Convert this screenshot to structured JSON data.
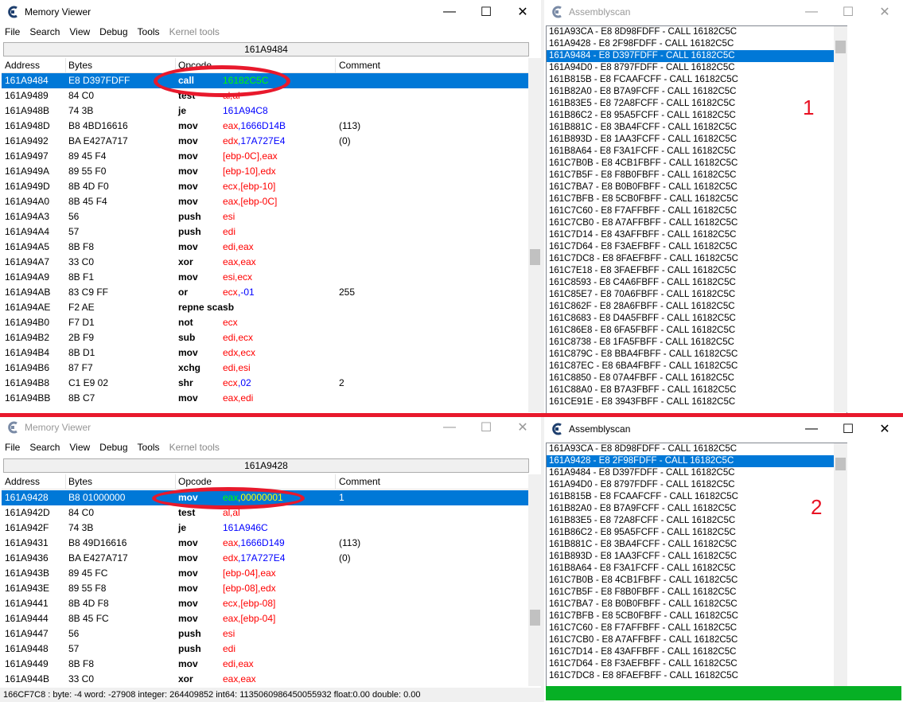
{
  "top_memory_viewer": {
    "title": "Memory Viewer",
    "menu": [
      "File",
      "Search",
      "View",
      "Debug",
      "Tools",
      "Kernel tools"
    ],
    "address_bar": "161A9484",
    "columns": {
      "address": "Address",
      "bytes": "Bytes",
      "opcode": "Opcode",
      "comment": "Comment"
    },
    "rows": [
      {
        "addr": "161A9484",
        "bytes": "E8 D397FDFF",
        "op": "call",
        "a1": "16182C5C",
        "a2": "",
        "comment": "",
        "selected": true
      },
      {
        "addr": "161A9489",
        "bytes": "84 C0",
        "op": "test",
        "a1": "al",
        "a2": ",al",
        "comment": ""
      },
      {
        "addr": "161A948B",
        "bytes": "74 3B",
        "op": "je",
        "a1": "161A94C8",
        "a2": "",
        "comment": ""
      },
      {
        "addr": "161A948D",
        "bytes": "B8 4BD16616",
        "op": "mov",
        "a1": "eax",
        "a2": ",1666D14B",
        "comment": "(113)"
      },
      {
        "addr": "161A9492",
        "bytes": "BA E427A717",
        "op": "mov",
        "a1": "edx",
        "a2": ",17A727E4",
        "comment": "(0)"
      },
      {
        "addr": "161A9497",
        "bytes": "89 45 F4",
        "op": "mov",
        "a1": "[ebp-0C]",
        "a2": ",eax",
        "comment": ""
      },
      {
        "addr": "161A949A",
        "bytes": "89 55 F0",
        "op": "mov",
        "a1": "[ebp-10]",
        "a2": ",edx",
        "comment": ""
      },
      {
        "addr": "161A949D",
        "bytes": "8B 4D F0",
        "op": "mov",
        "a1": "ecx",
        "a2": ",[ebp-10]",
        "comment": ""
      },
      {
        "addr": "161A94A0",
        "bytes": "8B 45 F4",
        "op": "mov",
        "a1": "eax",
        "a2": ",[ebp-0C]",
        "comment": ""
      },
      {
        "addr": "161A94A3",
        "bytes": "56",
        "op": "push",
        "a1": "esi",
        "a2": "",
        "comment": ""
      },
      {
        "addr": "161A94A4",
        "bytes": "57",
        "op": "push",
        "a1": "edi",
        "a2": "",
        "comment": ""
      },
      {
        "addr": "161A94A5",
        "bytes": "8B F8",
        "op": "mov",
        "a1": "edi",
        "a2": ",eax",
        "comment": ""
      },
      {
        "addr": "161A94A7",
        "bytes": "33 C0",
        "op": "xor",
        "a1": "eax",
        "a2": ",eax",
        "comment": ""
      },
      {
        "addr": "161A94A9",
        "bytes": "8B F1",
        "op": "mov",
        "a1": "esi",
        "a2": ",ecx",
        "comment": ""
      },
      {
        "addr": "161A94AB",
        "bytes": "83 C9 FF",
        "op": "or",
        "a1": "ecx",
        "a2": ",-01",
        "comment": "255"
      },
      {
        "addr": "161A94AE",
        "bytes": "F2 AE",
        "op": "repne scasb",
        "a1": "",
        "a2": "",
        "comment": ""
      },
      {
        "addr": "161A94B0",
        "bytes": "F7 D1",
        "op": "not",
        "a1": "ecx",
        "a2": "",
        "comment": ""
      },
      {
        "addr": "161A94B2",
        "bytes": "2B F9",
        "op": "sub",
        "a1": "edi",
        "a2": ",ecx",
        "comment": ""
      },
      {
        "addr": "161A94B4",
        "bytes": "8B D1",
        "op": "mov",
        "a1": "edx",
        "a2": ",ecx",
        "comment": ""
      },
      {
        "addr": "161A94B6",
        "bytes": "87 F7",
        "op": "xchg",
        "a1": "edi",
        "a2": ",esi",
        "comment": ""
      },
      {
        "addr": "161A94B8",
        "bytes": "C1 E9 02",
        "op": "shr",
        "a1": "ecx",
        "a2": ",02",
        "comment": "2"
      },
      {
        "addr": "161A94BB",
        "bytes": "8B C7",
        "op": "mov",
        "a1": "eax",
        "a2": ",edi",
        "comment": ""
      }
    ]
  },
  "bottom_memory_viewer": {
    "title": "Memory Viewer",
    "menu": [
      "File",
      "Search",
      "View",
      "Debug",
      "Tools",
      "Kernel tools"
    ],
    "address_bar": "161A9428",
    "columns": {
      "address": "Address",
      "bytes": "Bytes",
      "opcode": "Opcode",
      "comment": "Comment"
    },
    "rows": [
      {
        "addr": "161A9428",
        "bytes": "B8 01000000",
        "op": "mov",
        "a1": "eax",
        "a2": ",00000001",
        "comment": "1",
        "selected": true
      },
      {
        "addr": "161A942D",
        "bytes": "84 C0",
        "op": "test",
        "a1": "al",
        "a2": ",al",
        "comment": ""
      },
      {
        "addr": "161A942F",
        "bytes": "74 3B",
        "op": "je",
        "a1": "161A946C",
        "a2": "",
        "comment": ""
      },
      {
        "addr": "161A9431",
        "bytes": "B8 49D16616",
        "op": "mov",
        "a1": "eax",
        "a2": ",1666D149",
        "comment": "(113)"
      },
      {
        "addr": "161A9436",
        "bytes": "BA E427A717",
        "op": "mov",
        "a1": "edx",
        "a2": ",17A727E4",
        "comment": "(0)"
      },
      {
        "addr": "161A943B",
        "bytes": "89 45 FC",
        "op": "mov",
        "a1": "[ebp-04]",
        "a2": ",eax",
        "comment": ""
      },
      {
        "addr": "161A943E",
        "bytes": "89 55 F8",
        "op": "mov",
        "a1": "[ebp-08]",
        "a2": ",edx",
        "comment": ""
      },
      {
        "addr": "161A9441",
        "bytes": "8B 4D F8",
        "op": "mov",
        "a1": "ecx",
        "a2": ",[ebp-08]",
        "comment": ""
      },
      {
        "addr": "161A9444",
        "bytes": "8B 45 FC",
        "op": "mov",
        "a1": "eax",
        "a2": ",[ebp-04]",
        "comment": ""
      },
      {
        "addr": "161A9447",
        "bytes": "56",
        "op": "push",
        "a1": "esi",
        "a2": "",
        "comment": ""
      },
      {
        "addr": "161A9448",
        "bytes": "57",
        "op": "push",
        "a1": "edi",
        "a2": "",
        "comment": ""
      },
      {
        "addr": "161A9449",
        "bytes": "8B F8",
        "op": "mov",
        "a1": "edi",
        "a2": ",eax",
        "comment": ""
      },
      {
        "addr": "161A944B",
        "bytes": "33 C0",
        "op": "xor",
        "a1": "eax",
        "a2": ",eax",
        "comment": ""
      }
    ],
    "status": "166CF7C8 : byte: -4 word: -27908 integer: 264409852 int64: 1135060986450055932 float:0.00 double: 0.00"
  },
  "top_assemblyscan": {
    "title": "Assemblyscan",
    "annotation": "1",
    "items": [
      "161A93CA - E8 8D98FDFF - CALL 16182C5C",
      "161A9428 - E8 2F98FDFF - CALL 16182C5C",
      "161A9484 - E8 D397FDFF - CALL 16182C5C",
      "161A94D0 - E8 8797FDFF - CALL 16182C5C",
      "161B815B - E8 FCAAFCFF - CALL 16182C5C",
      "161B82A0 - E8 B7A9FCFF - CALL 16182C5C",
      "161B83E5 - E8 72A8FCFF - CALL 16182C5C",
      "161B86C2 - E8 95A5FCFF - CALL 16182C5C",
      "161B881C - E8 3BA4FCFF - CALL 16182C5C",
      "161B893D - E8 1AA3FCFF - CALL 16182C5C",
      "161B8A64 - E8 F3A1FCFF - CALL 16182C5C",
      "161C7B0B - E8 4CB1FBFF - CALL 16182C5C",
      "161C7B5F - E8 F8B0FBFF - CALL 16182C5C",
      "161C7BA7 - E8 B0B0FBFF - CALL 16182C5C",
      "161C7BFB - E8 5CB0FBFF - CALL 16182C5C",
      "161C7C60 - E8 F7AFFBFF - CALL 16182C5C",
      "161C7CB0 - E8 A7AFFBFF - CALL 16182C5C",
      "161C7D14 - E8 43AFFBFF - CALL 16182C5C",
      "161C7D64 - E8 F3AEFBFF - CALL 16182C5C",
      "161C7DC8 - E8 8FAEFBFF - CALL 16182C5C",
      "161C7E18 - E8 3FAEFBFF - CALL 16182C5C",
      "161C8593 - E8 C4A6FBFF - CALL 16182C5C",
      "161C85E7 - E8 70A6FBFF - CALL 16182C5C",
      "161C862F - E8 28A6FBFF - CALL 16182C5C",
      "161C8683 - E8 D4A5FBFF - CALL 16182C5C",
      "161C86E8 - E8 6FA5FBFF - CALL 16182C5C",
      "161C8738 - E8 1FA5FBFF - CALL 16182C5C",
      "161C879C - E8 BBA4FBFF - CALL 16182C5C",
      "161C87EC - E8 6BA4FBFF - CALL 16182C5C",
      "161C8850 - E8 07A4FBFF - CALL 16182C5C",
      "161C88A0 - E8 B7A3FBFF - CALL 16182C5C",
      "161CE91E - E8 3943FBFF - CALL 16182C5C"
    ],
    "selected_index": 2
  },
  "bottom_assemblyscan": {
    "title": "Assemblyscan",
    "annotation": "2",
    "items": [
      "161A93CA - E8 8D98FDFF - CALL 16182C5C",
      "161A9428 - E8 2F98FDFF - CALL 16182C5C",
      "161A9484 - E8 D397FDFF - CALL 16182C5C",
      "161A94D0 - E8 8797FDFF - CALL 16182C5C",
      "161B815B - E8 FCAAFCFF - CALL 16182C5C",
      "161B82A0 - E8 B7A9FCFF - CALL 16182C5C",
      "161B83E5 - E8 72A8FCFF - CALL 16182C5C",
      "161B86C2 - E8 95A5FCFF - CALL 16182C5C",
      "161B881C - E8 3BA4FCFF - CALL 16182C5C",
      "161B893D - E8 1AA3FCFF - CALL 16182C5C",
      "161B8A64 - E8 F3A1FCFF - CALL 16182C5C",
      "161C7B0B - E8 4CB1FBFF - CALL 16182C5C",
      "161C7B5F - E8 F8B0FBFF - CALL 16182C5C",
      "161C7BA7 - E8 B0B0FBFF - CALL 16182C5C",
      "161C7BFB - E8 5CB0FBFF - CALL 16182C5C",
      "161C7C60 - E8 F7AFFBFF - CALL 16182C5C",
      "161C7CB0 - E8 A7AFFBFF - CALL 16182C5C",
      "161C7D14 - E8 43AFFBFF - CALL 16182C5C",
      "161C7D64 - E8 F3AEFBFF - CALL 16182C5C",
      "161C7DC8 - E8 8FAEFBFF - CALL 16182C5C"
    ],
    "selected_index": 1
  },
  "window_controls": {
    "minimize": "—",
    "maximize": "☐",
    "close": "✕"
  },
  "colors": {
    "selection": "#0078d7",
    "annotation": "#e81123",
    "register": "#ff0000",
    "number": "#0000ff",
    "progress": "#06b025"
  }
}
